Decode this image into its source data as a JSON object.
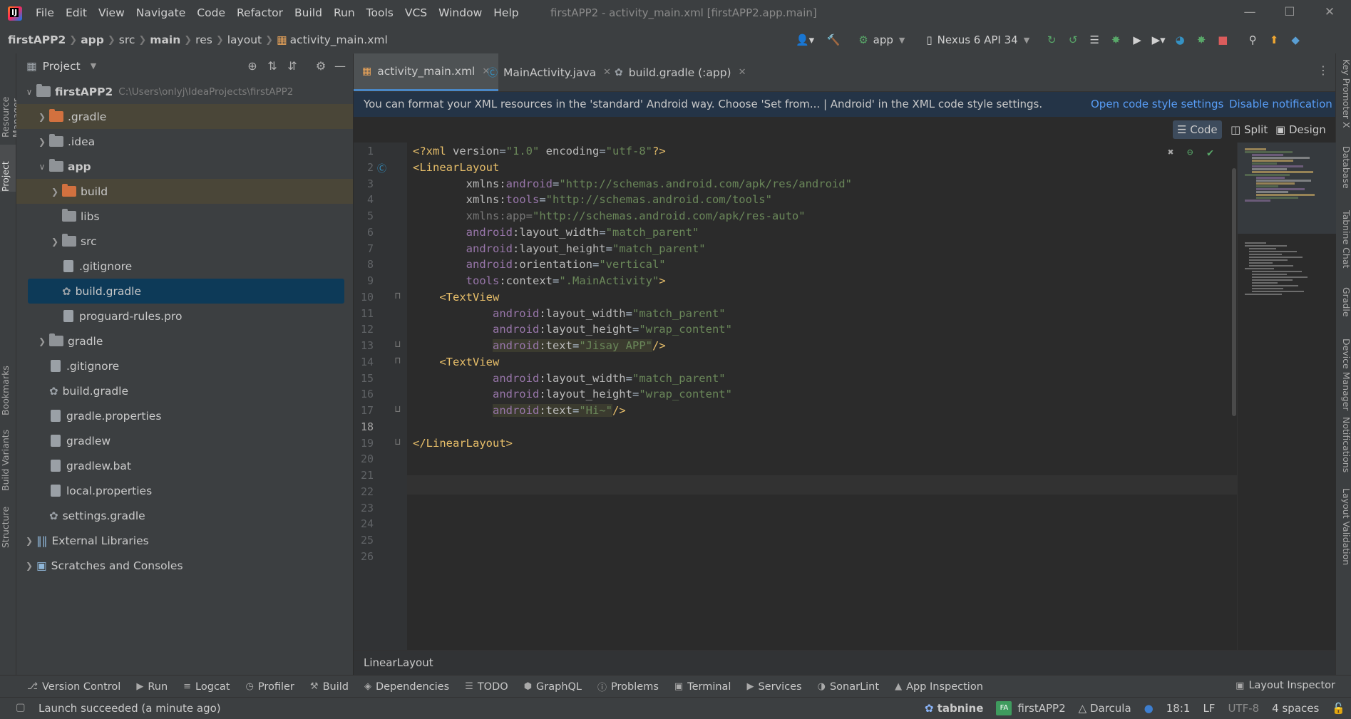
{
  "menu": [
    "File",
    "Edit",
    "View",
    "Navigate",
    "Code",
    "Refactor",
    "Build",
    "Run",
    "Tools",
    "VCS",
    "Window",
    "Help"
  ],
  "window_title": "firstAPP2 - activity_main.xml [firstAPP2.app.main]",
  "breadcrumbs": [
    "firstAPP2",
    "app",
    "src",
    "main",
    "res",
    "layout",
    "activity_main.xml"
  ],
  "toolbar": {
    "run_config": "app",
    "device": "Nexus 6 API 34"
  },
  "left_tools": [
    "Resource Manager",
    "Project",
    "Bookmarks",
    "Build Variants",
    "Structure"
  ],
  "right_tools": [
    "Key Promoter X",
    "Database",
    "Tabnine Chat",
    "Gradle",
    "Device Manager",
    "Notifications",
    "Layout Validation"
  ],
  "project_panel": {
    "title": "Project",
    "tree": [
      {
        "label": "firstAPP2",
        "hint": "C:\\Users\\onlyj\\IdeaProjects\\firstAPP2",
        "depth": 0,
        "arrow": "open",
        "icon": "module-folder",
        "bold": true
      },
      {
        "label": ".gradle",
        "depth": 1,
        "arrow": "closed",
        "icon": "orange-folder",
        "style": "excluded"
      },
      {
        "label": ".idea",
        "depth": 1,
        "arrow": "closed",
        "icon": "folder"
      },
      {
        "label": "app",
        "depth": 1,
        "arrow": "open",
        "icon": "module-folder",
        "bold": true
      },
      {
        "label": "build",
        "depth": 2,
        "arrow": "closed",
        "icon": "orange-folder",
        "style": "excluded"
      },
      {
        "label": "libs",
        "depth": 2,
        "arrow": "none",
        "icon": "folder"
      },
      {
        "label": "src",
        "depth": 2,
        "arrow": "closed",
        "icon": "folder"
      },
      {
        "label": ".gitignore",
        "depth": 2,
        "arrow": "none",
        "icon": "file"
      },
      {
        "label": "build.gradle",
        "depth": 2,
        "arrow": "none",
        "icon": "gradle",
        "style": "selected"
      },
      {
        "label": "proguard-rules.pro",
        "depth": 2,
        "arrow": "none",
        "icon": "file"
      },
      {
        "label": "gradle",
        "depth": 1,
        "arrow": "closed",
        "icon": "folder"
      },
      {
        "label": ".gitignore",
        "depth": 1,
        "arrow": "none",
        "icon": "file"
      },
      {
        "label": "build.gradle",
        "depth": 1,
        "arrow": "none",
        "icon": "gradle"
      },
      {
        "label": "gradle.properties",
        "depth": 1,
        "arrow": "none",
        "icon": "file"
      },
      {
        "label": "gradlew",
        "depth": 1,
        "arrow": "none",
        "icon": "file"
      },
      {
        "label": "gradlew.bat",
        "depth": 1,
        "arrow": "none",
        "icon": "file"
      },
      {
        "label": "local.properties",
        "depth": 1,
        "arrow": "none",
        "icon": "file"
      },
      {
        "label": "settings.gradle",
        "depth": 1,
        "arrow": "none",
        "icon": "gradle"
      },
      {
        "label": "External Libraries",
        "depth": 0,
        "arrow": "closed",
        "icon": "library"
      },
      {
        "label": "Scratches and Consoles",
        "depth": 0,
        "arrow": "closed",
        "icon": "scratch"
      }
    ]
  },
  "editor_tabs": [
    {
      "label": "activity_main.xml",
      "active": true
    },
    {
      "label": "MainActivity.java",
      "active": false
    },
    {
      "label": "build.gradle (:app)",
      "active": false
    }
  ],
  "notification": {
    "text": "You can format your XML resources in the 'standard' Android way. Choose 'Set from... | Android' in the XML code style settings.",
    "link1": "Open code style settings",
    "link2": "Disable notification"
  },
  "view_modes": [
    "Code",
    "Split",
    "Design"
  ],
  "code_lines": [
    [
      [
        "t-pi",
        "<?xml "
      ],
      [
        "t-attr",
        "version"
      ],
      [
        "",
        "="
      ],
      [
        "t-val",
        "\"1.0\" "
      ],
      [
        "t-attr",
        "encoding"
      ],
      [
        "",
        "="
      ],
      [
        "t-val",
        "\"utf-8\""
      ],
      [
        "t-pi",
        "?>"
      ]
    ],
    [
      [
        "t-tag",
        "<LinearLayout"
      ]
    ],
    [
      [
        "",
        "        "
      ],
      [
        "t-attr",
        "xmlns:"
      ],
      [
        "t-ns",
        "android"
      ],
      [
        "",
        "="
      ],
      [
        "t-val",
        "\"http://schemas.android.com/apk/res/android\""
      ]
    ],
    [
      [
        "",
        "        "
      ],
      [
        "t-attr",
        "xmlns:"
      ],
      [
        "t-ns",
        "tools"
      ],
      [
        "",
        "="
      ],
      [
        "t-val",
        "\"http://schemas.android.com/tools\""
      ]
    ],
    [
      [
        "",
        "        "
      ],
      [
        "t-gray",
        "xmlns:app="
      ],
      [
        "t-val",
        "\"http://schemas.android.com/apk/res-auto\""
      ]
    ],
    [
      [
        "",
        "        "
      ],
      [
        "t-ns",
        "android"
      ],
      [
        "t-attr",
        ":layout_width"
      ],
      [
        "",
        "="
      ],
      [
        "t-val",
        "\"match_parent\""
      ]
    ],
    [
      [
        "",
        "        "
      ],
      [
        "t-ns",
        "android"
      ],
      [
        "t-attr",
        ":layout_height"
      ],
      [
        "",
        "="
      ],
      [
        "t-val",
        "\"match_parent\""
      ]
    ],
    [
      [
        "",
        "        "
      ],
      [
        "t-ns",
        "android"
      ],
      [
        "t-attr",
        ":orientation"
      ],
      [
        "",
        "="
      ],
      [
        "t-val",
        "\"vertical\""
      ]
    ],
    [
      [
        "",
        "        "
      ],
      [
        "t-ns",
        "tools"
      ],
      [
        "t-attr",
        ":context"
      ],
      [
        "",
        "="
      ],
      [
        "t-val",
        "\".MainActivity\""
      ],
      [
        "t-tag",
        ">"
      ]
    ],
    [
      [
        "",
        "    "
      ],
      [
        "t-tag",
        "<TextView"
      ]
    ],
    [
      [
        "",
        "            "
      ],
      [
        "t-ns",
        "android"
      ],
      [
        "t-attr",
        ":layout_width"
      ],
      [
        "",
        "="
      ],
      [
        "t-val",
        "\"match_parent\""
      ]
    ],
    [
      [
        "",
        "            "
      ],
      [
        "t-ns",
        "android"
      ],
      [
        "t-attr",
        ":layout_height"
      ],
      [
        "",
        "="
      ],
      [
        "t-val",
        "\"wrap_content\""
      ]
    ],
    [
      [
        "",
        "            "
      ],
      [
        "t-ns hl",
        "android"
      ],
      [
        "t-attr hl",
        ":text"
      ],
      [
        "hl",
        "="
      ],
      [
        "t-val hl",
        "\"Jisay APP\""
      ],
      [
        "t-tag",
        "/>"
      ]
    ],
    [
      [
        "",
        "    "
      ],
      [
        "t-tag",
        "<TextView"
      ]
    ],
    [
      [
        "",
        "            "
      ],
      [
        "t-ns",
        "android"
      ],
      [
        "t-attr",
        ":layout_width"
      ],
      [
        "",
        "="
      ],
      [
        "t-val",
        "\"match_parent\""
      ]
    ],
    [
      [
        "",
        "            "
      ],
      [
        "t-ns",
        "android"
      ],
      [
        "t-attr",
        ":layout_height"
      ],
      [
        "",
        "="
      ],
      [
        "t-val",
        "\"wrap_content\""
      ]
    ],
    [
      [
        "",
        "            "
      ],
      [
        "t-ns hl",
        "android"
      ],
      [
        "t-attr hl",
        ":text"
      ],
      [
        "hl",
        "="
      ],
      [
        "t-val hl",
        "\"Hi~\""
      ],
      [
        "t-tag",
        "/>"
      ]
    ],
    [],
    [
      [
        "t-tag",
        "</LinearLayout>"
      ]
    ],
    [],
    [],
    [],
    [],
    [],
    [],
    []
  ],
  "context_label": "LinearLayout",
  "bottom_tools": [
    "Version Control",
    "Run",
    "Logcat",
    "Profiler",
    "Build",
    "Dependencies",
    "TODO",
    "GraphQL",
    "Problems",
    "Terminal",
    "Services",
    "SonarLint",
    "App Inspection"
  ],
  "layout_inspector": "Layout Inspector",
  "status": {
    "message": "Launch succeeded (a minute ago)",
    "tabnine": "tabnine",
    "project_badge": "FA",
    "project": "firstAPP2",
    "theme": "Darcula",
    "position": "18:1",
    "line_sep": "LF",
    "encoding": "UTF-8",
    "indent": "4 spaces"
  }
}
